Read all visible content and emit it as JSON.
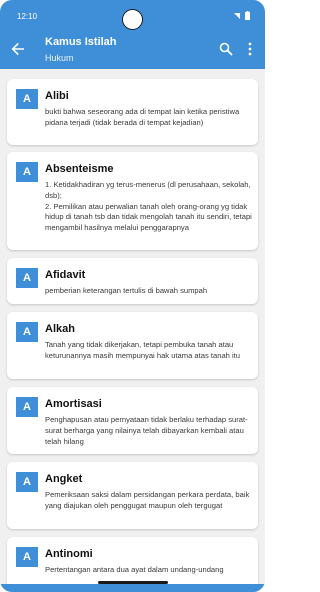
{
  "status_bar": {
    "time": "12:10"
  },
  "app_bar": {
    "title": "Kamus Istilah",
    "subtitle": "Hukum",
    "back_icon": "arrow-back-icon",
    "search_icon": "search-icon",
    "more_icon": "more-vert-icon"
  },
  "colors": {
    "primary": "#3f8fd8",
    "background": "#f0f0f0",
    "card": "#ffffff"
  },
  "entries": [
    {
      "letter": "A",
      "term": "Alibi",
      "definition": "bukti bahwa seseorang ada di tempat lain ketika peristiwa pidana terjadi (tidak berada di tempat kejadian)"
    },
    {
      "letter": "A",
      "term": "Absenteisme",
      "definition": "1. Ketidakhadiran yg terus-menerus (dl perusahaan, sekolah, dsb);\n2. Pemilikan atau perwalian tanah oleh orang-orang yg tidak hidup di tanah tsb dan tidak mengolah tanah itu sendiri, tetapi mengambil hasilnya melalui penggarapnya"
    },
    {
      "letter": "A",
      "term": "Afidavit",
      "definition": "pemberian keterangan tertulis di bawah sumpah"
    },
    {
      "letter": "A",
      "term": "Alkah",
      "definition": "Tanah yang tidak dikerjakan, tetapi pembuka tanah atau keturunannya masih mempunyai hak utama atas tanah itu"
    },
    {
      "letter": "A",
      "term": "Amortisasi",
      "definition": "Penghapusan atau pernyataan tidak berlaku terhadap surat-surat berharga yang nilainya telah dibayarkan kembali atau telah hilang"
    },
    {
      "letter": "A",
      "term": "Angket",
      "definition": "Pemeriksaan saksi dalam persidangan perkara perdata, baik yang diajukan oleh penggugat maupun oleh tergugat"
    },
    {
      "letter": "A",
      "term": "Antinomi",
      "definition": "Pertentangan antara dua ayat dalam undang-undang"
    }
  ]
}
